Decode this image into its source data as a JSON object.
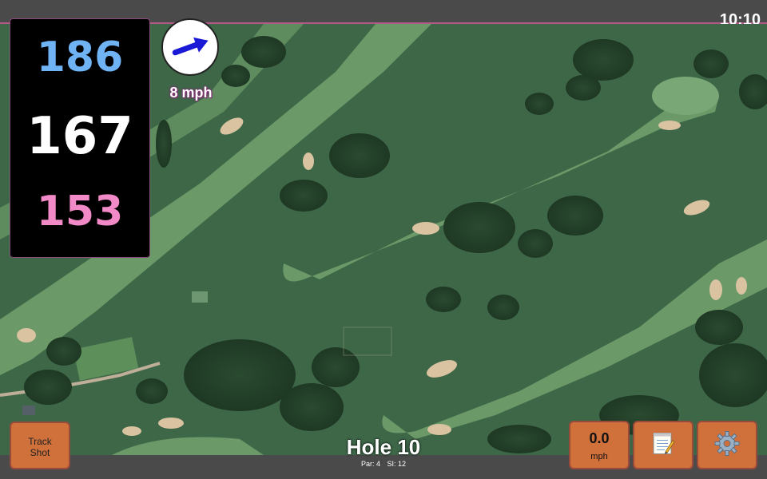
{
  "status": {
    "time": "10:10"
  },
  "distances": {
    "back": "186",
    "center": "167",
    "front": "153"
  },
  "wind": {
    "speed_label": "8 mph",
    "icon": "wind-arrow-icon",
    "direction": "east-northeast"
  },
  "hole": {
    "title": "Hole 10",
    "par_label": "Par: 4",
    "si_label": "SI: 12"
  },
  "buttons": {
    "track_shot_line1": "Track",
    "track_shot_line2": "Shot",
    "speed_value": "0.0",
    "speed_unit": "mph",
    "notes_icon": "notepad-icon",
    "settings_icon": "gear-icon"
  },
  "colors": {
    "back_distance": "#6fb3f5",
    "center_distance": "#ffffff",
    "front_distance": "#f28ac7",
    "button": "#d0703a",
    "accent": "#b25a8a"
  }
}
